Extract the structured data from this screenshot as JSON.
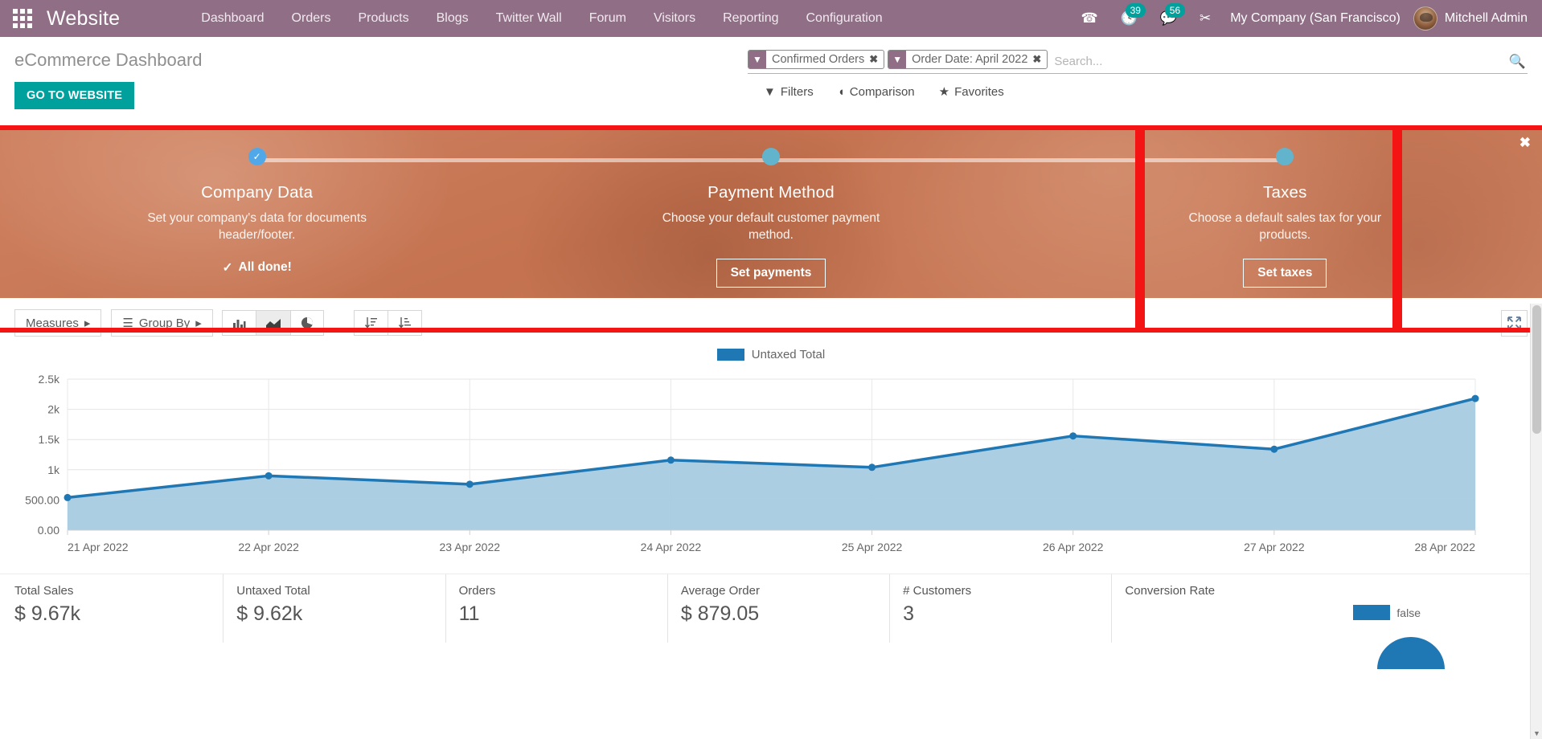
{
  "navbar": {
    "apps_icon": "grid-apps-icon",
    "brand": "Website",
    "menu": [
      "Dashboard",
      "Orders",
      "Products",
      "Blogs",
      "Twitter Wall",
      "Forum",
      "Visitors",
      "Reporting",
      "Configuration"
    ],
    "phone_icon": "phone-icon",
    "activities": {
      "icon": "clock-activities-icon",
      "count": "39"
    },
    "messages": {
      "icon": "chat-messages-icon",
      "count": "56"
    },
    "debug_icon": "bug-debug-icon",
    "company": "My Company (San Francisco)",
    "user": "Mitchell Admin",
    "accent": "#8f6e86",
    "badge_color": "#00a09d"
  },
  "control_panel": {
    "title": "eCommerce Dashboard",
    "website_button": "GO TO WEBSITE",
    "website_button_color": "#00a09d",
    "search": {
      "placeholder": "Search...",
      "value": "",
      "facets": [
        {
          "label": "Confirmed Orders",
          "icon": "filter-icon",
          "remove": "✖"
        },
        {
          "label": "Order Date: April 2022",
          "icon": "filter-icon",
          "remove": "✖"
        }
      ]
    },
    "tools": [
      {
        "label": "Filters",
        "icon": "filter-icon"
      },
      {
        "label": "Comparison",
        "icon": "comparison-icon"
      },
      {
        "label": "Favorites",
        "icon": "star-icon"
      }
    ]
  },
  "onboarding": {
    "close_label": "✖",
    "highlight_color": "#f41414",
    "steps": [
      {
        "title": "Company Data",
        "description": "Set your company's data for documents header/footer.",
        "state": "done",
        "done_label": "All done!",
        "action": null
      },
      {
        "title": "Payment Method",
        "description": "Choose your default customer payment method.",
        "state": "todo",
        "done_label": null,
        "action": "Set payments"
      },
      {
        "title": "Taxes",
        "description": "Choose a default sales tax for your products.",
        "state": "todo",
        "done_label": null,
        "action": "Set taxes"
      }
    ]
  },
  "chart_toolbar": {
    "measures": "Measures",
    "group_by": "Group By",
    "view_buttons": [
      {
        "name": "bar-chart-icon",
        "active": false
      },
      {
        "name": "line-chart-icon",
        "active": true
      },
      {
        "name": "pie-chart-icon",
        "active": false
      }
    ],
    "sort_buttons": [
      {
        "name": "sort-descending-icon"
      },
      {
        "name": "sort-ascending-icon"
      }
    ],
    "expand": "expand-icon"
  },
  "chart_data": {
    "type": "area",
    "title": "",
    "subtitle": "",
    "xlabel": "",
    "ylabel": "",
    "categories": [
      "21 Apr 2022",
      "22 Apr 2022",
      "23 Apr 2022",
      "24 Apr 2022",
      "25 Apr 2022",
      "26 Apr 2022",
      "27 Apr 2022",
      "28 Apr 2022"
    ],
    "series": [
      {
        "name": "Untaxed Total",
        "color": "#1f77b4",
        "values": [
          540,
          900,
          760,
          1160,
          1040,
          1560,
          1340,
          2180
        ]
      }
    ],
    "ylim": [
      0,
      2500
    ],
    "yticks": [
      0,
      500,
      1000,
      1500,
      2000,
      2500
    ],
    "ytick_labels": [
      "0.00",
      "500.00",
      "1k",
      "1.5k",
      "2k",
      "2.5k"
    ],
    "grid": true,
    "legend": {
      "position": "top",
      "entries": [
        "Untaxed Total"
      ]
    },
    "fill_color": "#a8cbe2",
    "line_color": "#1f77b4"
  },
  "kpis": [
    {
      "label": "Total Sales",
      "value": "$ 9.67k"
    },
    {
      "label": "Untaxed Total",
      "value": "$ 9.62k"
    },
    {
      "label": "Orders",
      "value": "11"
    },
    {
      "label": "Average Order",
      "value": "$ 879.05"
    },
    {
      "label": "# Customers",
      "value": "3"
    }
  ],
  "conversion": {
    "label": "Conversion Rate",
    "legend_entry": "false",
    "legend_color": "#1f77b4"
  }
}
